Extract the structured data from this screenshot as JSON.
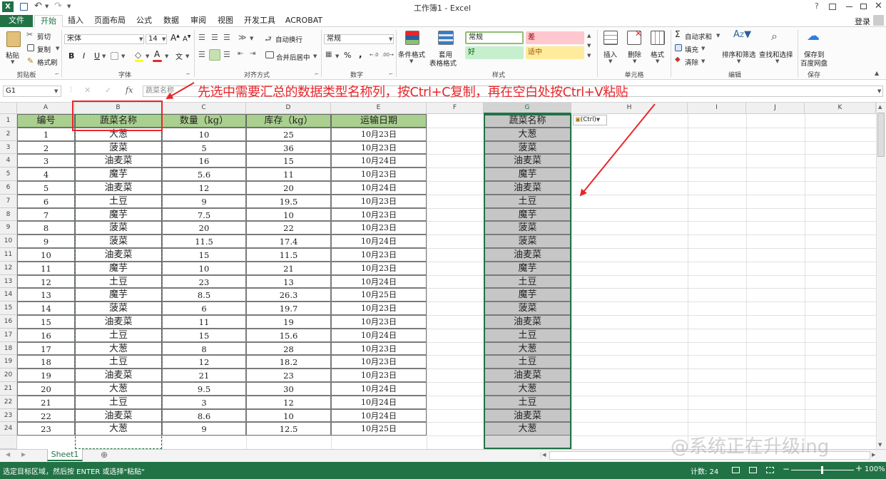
{
  "window": {
    "title": "工作簿1 - Excel",
    "sign_in": "登录",
    "help": "?"
  },
  "tabs": [
    {
      "label": "文件"
    },
    {
      "label": "开始"
    },
    {
      "label": "插入"
    },
    {
      "label": "页面布局"
    },
    {
      "label": "公式"
    },
    {
      "label": "数据"
    },
    {
      "label": "审阅"
    },
    {
      "label": "视图"
    },
    {
      "label": "开发工具"
    },
    {
      "label": "ACROBAT"
    }
  ],
  "ribbon": {
    "clipboard": {
      "paste": "粘贴",
      "cut": "剪切",
      "copy": "复制",
      "format_painter": "格式刷",
      "group": "剪贴板"
    },
    "font": {
      "name": "宋体",
      "size": "14",
      "bold": "B",
      "italic": "I",
      "underline": "U",
      "group": "字体",
      "color_letter": "A"
    },
    "alignment": {
      "wrap": "自动换行",
      "merge": "合并后居中",
      "group": "对齐方式"
    },
    "number": {
      "format": "常规",
      "percent": "%",
      "comma": ",",
      "group": "数字"
    },
    "styles": {
      "conditional": "条件格式",
      "table_format_1": "套用",
      "table_format_2": "表格格式",
      "normal": "常规",
      "bad": "差",
      "good": "好",
      "neutral": "适中",
      "group": "样式"
    },
    "cells": {
      "insert": "插入",
      "delete": "删除",
      "format": "格式",
      "group": "单元格"
    },
    "editing": {
      "autosum": "自动求和",
      "fill": "填充",
      "clear": "清除",
      "sort": "排序和筛选",
      "find": "查找和选择",
      "group": "编辑"
    },
    "save": {
      "label1": "保存到",
      "label2": "百度网盘",
      "group": "保存"
    }
  },
  "formula_bar": {
    "name_box": "G1",
    "fx": "fx",
    "content": "蔬菜名称"
  },
  "annotation": "先选中需要汇总的数据类型名称列，按Ctrl+C复制，再在空白处按Ctrl+V粘贴",
  "paste_options": "(Ctrl)",
  "columns": [
    "A",
    "B",
    "C",
    "D",
    "E",
    "F",
    "G",
    "H",
    "I",
    "J",
    "K"
  ],
  "headers": [
    "编号",
    "蔬菜名称",
    "数量（kg）",
    "库存（kg）",
    "运输日期"
  ],
  "rows": [
    [
      "1",
      "大葱",
      "10",
      "25",
      "10月23日"
    ],
    [
      "2",
      "菠菜",
      "5",
      "36",
      "10月23日"
    ],
    [
      "3",
      "油麦菜",
      "16",
      "15",
      "10月24日"
    ],
    [
      "4",
      "魔芋",
      "5.6",
      "11",
      "10月23日"
    ],
    [
      "5",
      "油麦菜",
      "12",
      "20",
      "10月24日"
    ],
    [
      "6",
      "土豆",
      "9",
      "19.5",
      "10月23日"
    ],
    [
      "7",
      "魔芋",
      "7.5",
      "10",
      "10月23日"
    ],
    [
      "8",
      "菠菜",
      "20",
      "22",
      "10月23日"
    ],
    [
      "9",
      "菠菜",
      "11.5",
      "17.4",
      "10月24日"
    ],
    [
      "10",
      "油麦菜",
      "15",
      "11.5",
      "10月23日"
    ],
    [
      "11",
      "魔芋",
      "10",
      "21",
      "10月23日"
    ],
    [
      "12",
      "土豆",
      "23",
      "13",
      "10月24日"
    ],
    [
      "13",
      "魔芋",
      "8.5",
      "26.3",
      "10月25日"
    ],
    [
      "14",
      "菠菜",
      "6",
      "19.7",
      "10月23日"
    ],
    [
      "15",
      "油麦菜",
      "11",
      "19",
      "10月23日"
    ],
    [
      "16",
      "土豆",
      "15",
      "15.6",
      "10月24日"
    ],
    [
      "17",
      "大葱",
      "8",
      "28",
      "10月23日"
    ],
    [
      "18",
      "土豆",
      "12",
      "18.2",
      "10月23日"
    ],
    [
      "19",
      "油麦菜",
      "21",
      "23",
      "10月23日"
    ],
    [
      "20",
      "大葱",
      "9.5",
      "30",
      "10月24日"
    ],
    [
      "21",
      "土豆",
      "3",
      "12",
      "10月24日"
    ],
    [
      "22",
      "油麦菜",
      "8.6",
      "10",
      "10月24日"
    ],
    [
      "23",
      "大葱",
      "9",
      "12.5",
      "10月25日"
    ]
  ],
  "pasted_header": "蔬菜名称",
  "pasted": [
    "大葱",
    "菠菜",
    "油麦菜",
    "魔芋",
    "油麦菜",
    "土豆",
    "魔芋",
    "菠菜",
    "菠菜",
    "油麦菜",
    "魔芋",
    "土豆",
    "魔芋",
    "菠菜",
    "油麦菜",
    "土豆",
    "大葱",
    "土豆",
    "油麦菜",
    "大葱",
    "土豆",
    "油麦菜",
    "大葱"
  ],
  "sheet_tab": "Sheet1",
  "add_sheet": "⊕",
  "status": {
    "message": "选定目标区域，然后按 ENTER 或选择\"粘贴\"",
    "count": "计数: 24",
    "zoom": "100%"
  },
  "watermark": "@系统正在升级ing",
  "colors": {
    "excel_green": "#217346",
    "header_fill": "#a9d08e",
    "pasted_fill": "#c6c6c6",
    "annotation_red": "#e8262a"
  }
}
